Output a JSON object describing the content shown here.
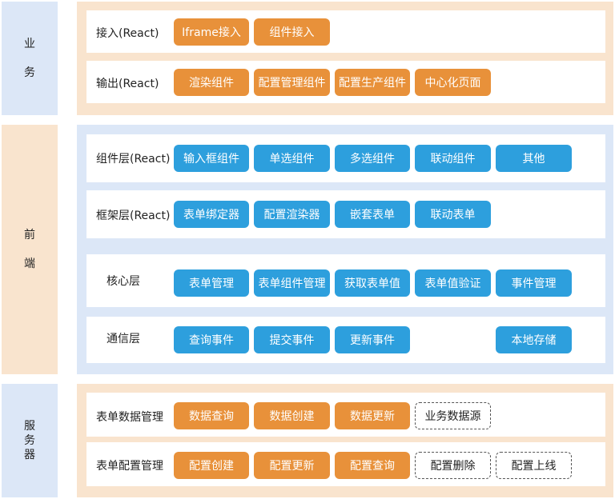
{
  "colors": {
    "business_bg": "#F9E4CE",
    "frontend_bg": "#DCE7F7",
    "service_bg": "#F9E4CE",
    "side_bg": "#DCE7F7",
    "orange": "#E8913A",
    "blue": "#2D9FDD"
  },
  "sections": {
    "business": {
      "label_chars": [
        "业",
        "务"
      ],
      "rows": [
        {
          "label": "接入(React)",
          "chips": [
            "Iframe接入",
            "组件接入"
          ]
        },
        {
          "label": "输出(React)",
          "chips": [
            "渲染组件",
            "配置管理组件",
            "配置生产组件",
            "中心化页面"
          ]
        }
      ]
    },
    "frontend": {
      "label_chars": [
        "前",
        "端"
      ],
      "rows": [
        {
          "label": "组件层(React)",
          "chips": [
            "输入框组件",
            "单选组件",
            "多选组件",
            "联动组件",
            "其他"
          ]
        },
        {
          "label": "框架层(React)",
          "chips": [
            "表单绑定器",
            "配置渲染器",
            "嵌套表单",
            "联动表单"
          ]
        },
        {
          "label": "核心层",
          "chips": [
            "表单管理",
            "表单组件管理",
            "获取表单值",
            "表单值验证",
            "事件管理"
          ]
        },
        {
          "label": "通信层",
          "chips": [
            "查询事件",
            "提交事件",
            "更新事件",
            "本地存储"
          ]
        }
      ]
    },
    "service": {
      "label_chars": [
        "服",
        "务",
        "器"
      ],
      "rows": [
        {
          "label": "表单数据管理",
          "chips": [
            "数据查询",
            "数据创建",
            "数据更新",
            "业务数据源"
          ]
        },
        {
          "label": "表单配置管理",
          "chips": [
            "配置创建",
            "配置更新",
            "配置查询",
            "配置删除",
            "配置上线"
          ]
        }
      ]
    }
  }
}
